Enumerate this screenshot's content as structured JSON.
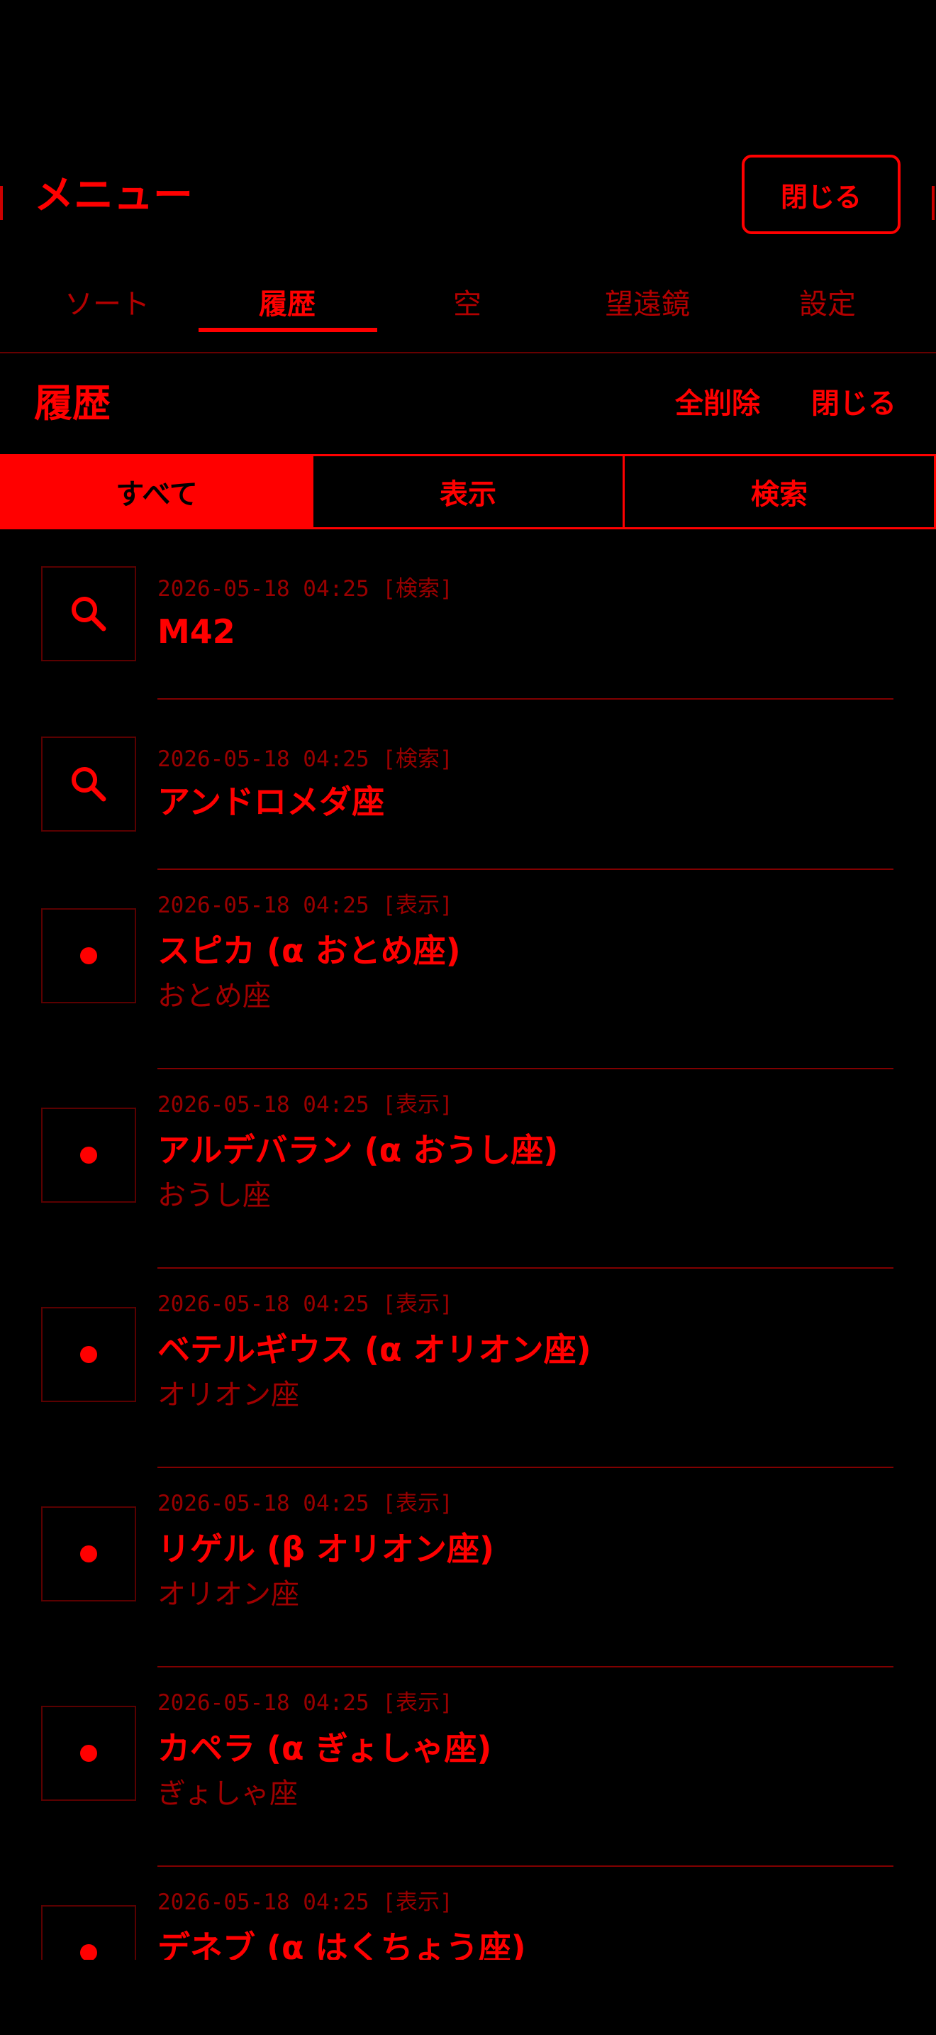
{
  "header": {
    "title": "メニュー",
    "close_label": "閉じる"
  },
  "tabs": [
    {
      "label": "ソート",
      "active": false
    },
    {
      "label": "履歴",
      "active": true
    },
    {
      "label": "空",
      "active": false
    },
    {
      "label": "望遠鏡",
      "active": false
    },
    {
      "label": "設定",
      "active": false
    }
  ],
  "section": {
    "title": "履歴",
    "clear_all_label": "全削除",
    "close_label": "閉じる"
  },
  "filter": {
    "options": [
      "すべて",
      "表示",
      "検索"
    ],
    "selected": "すべて"
  },
  "history": [
    {
      "type": "search",
      "icon": "search-icon",
      "timestamp": "2026-05-18 04:25 [検索]",
      "name": "M42",
      "constellation": ""
    },
    {
      "type": "search",
      "icon": "search-icon",
      "timestamp": "2026-05-18 04:25 [検索]",
      "name": "アンドロメダ座",
      "constellation": ""
    },
    {
      "type": "view",
      "icon": "dot-icon",
      "timestamp": "2026-05-18 04:25 [表示]",
      "name": "スピカ (α おとめ座)",
      "constellation": "おとめ座"
    },
    {
      "type": "view",
      "icon": "dot-icon",
      "timestamp": "2026-05-18 04:25 [表示]",
      "name": "アルデバラン (α おうし座)",
      "constellation": "おうし座"
    },
    {
      "type": "view",
      "icon": "dot-icon",
      "timestamp": "2026-05-18 04:25 [表示]",
      "name": "ベテルギウス (α オリオン座)",
      "constellation": "オリオン座"
    },
    {
      "type": "view",
      "icon": "dot-icon",
      "timestamp": "2026-05-18 04:25 [表示]",
      "name": "リゲル (β オリオン座)",
      "constellation": "オリオン座"
    },
    {
      "type": "view",
      "icon": "dot-icon",
      "timestamp": "2026-05-18 04:25 [表示]",
      "name": "カペラ (α ぎょしゃ座)",
      "constellation": "ぎょしゃ座"
    },
    {
      "type": "view",
      "icon": "dot-icon",
      "timestamp": "2026-05-18 04:25 [表示]",
      "name": "デネブ (α はくちょう座)",
      "constellation": ""
    }
  ],
  "colors": {
    "background": "#000000",
    "accent": "#ff0000",
    "dim": "#990000"
  }
}
